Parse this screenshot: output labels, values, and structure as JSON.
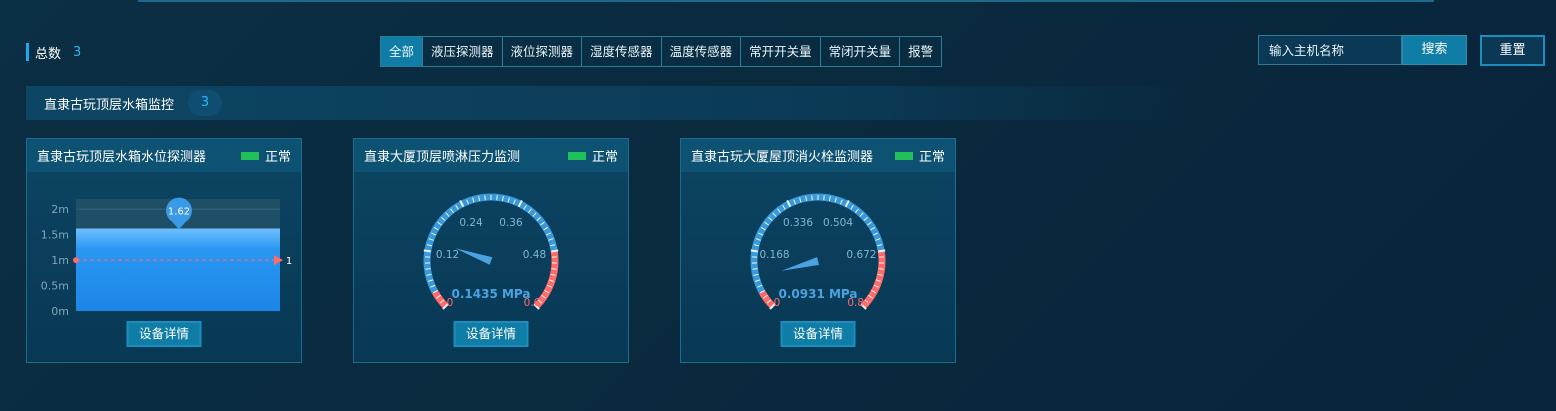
{
  "summary": {
    "label": "总数",
    "count": "3"
  },
  "tabs": [
    {
      "label": "全部",
      "active": true
    },
    {
      "label": "液压探测器"
    },
    {
      "label": "液位探测器"
    },
    {
      "label": "湿度传感器"
    },
    {
      "label": "温度传感器"
    },
    {
      "label": "常开开关量"
    },
    {
      "label": "常闭开关量"
    },
    {
      "label": "报警"
    }
  ],
  "search": {
    "placeholder": "输入主机名称",
    "button": "搜索",
    "reset": "重置"
  },
  "group": {
    "title": "直隶古玩顶层水箱监控",
    "count": "3"
  },
  "colors": {
    "accent": "#1ea8f0",
    "status_ok": "#20c05a",
    "alarm": "#ff6b6b",
    "gauge": "#3a9ad9"
  },
  "cards": [
    {
      "name": "直隶古玩顶层水箱水位探测器",
      "status": "正常",
      "button": "设备详情",
      "chart_data": {
        "type": "area",
        "y_ticks": [
          "2m",
          "1.5m",
          "1m",
          "0.5m",
          "0m"
        ],
        "ylim": [
          0,
          2.2
        ],
        "value": 1.62,
        "value_label": "1.62",
        "threshold": 1,
        "threshold_label": "1"
      }
    },
    {
      "name": "直隶大厦顶层喷淋压力监测",
      "status": "正常",
      "button": "设备详情",
      "gauge": {
        "min": 0,
        "max": 0.6,
        "value": 0.1435,
        "value_text": "0.1435 MPa",
        "labels": [
          "0",
          "0.12",
          "0.24",
          "0.36",
          "0.48",
          "0.6"
        ]
      }
    },
    {
      "name": "直隶古玩大厦屋顶消火栓监测器",
      "status": "正常",
      "button": "设备详情",
      "gauge": {
        "min": 0,
        "max": 0.84,
        "value": 0.0931,
        "value_text": "0.0931 MPa",
        "labels": [
          "0",
          "0.168",
          "0.336",
          "0.504",
          "0.672",
          "0.84"
        ]
      }
    }
  ]
}
